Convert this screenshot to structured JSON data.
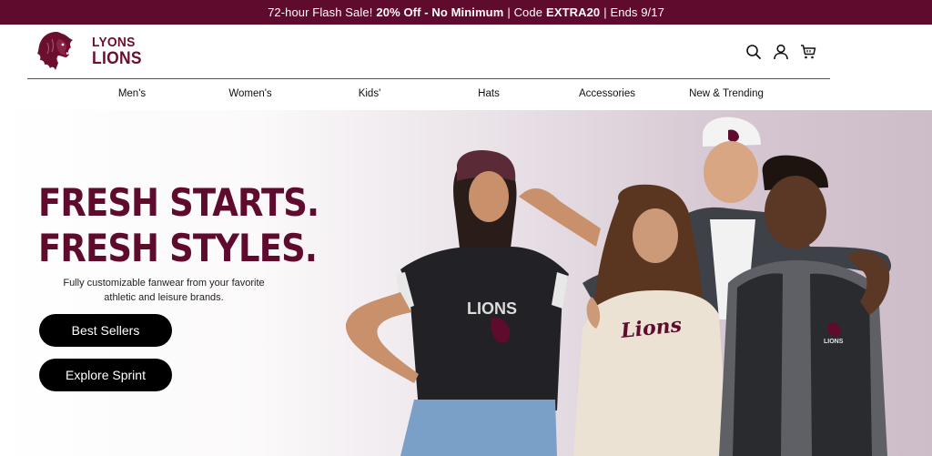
{
  "promo": {
    "part1": "72-hour Flash Sale!",
    "bold": "20% Off - No Minimum",
    "part2": "| Code",
    "code": "EXTRA20",
    "part3": "| Ends 9/17"
  },
  "brand": {
    "line1": "LYONS",
    "line2": "LIONS",
    "color": "#6b0f2e"
  },
  "header_icons": [
    "search-icon",
    "account-icon",
    "cart-icon"
  ],
  "nav": {
    "items": [
      {
        "label": "Men's"
      },
      {
        "label": "Women's"
      },
      {
        "label": "Kids'"
      },
      {
        "label": "Hats"
      },
      {
        "label": "Accessories"
      },
      {
        "label": "New & Trending"
      }
    ]
  },
  "hero": {
    "headline_line1": "FRESH STARTS.",
    "headline_line2": "FRESH STYLES.",
    "subtext": "Fully customizable fanwear from your favorite athletic and leisure brands.",
    "buttons": [
      {
        "label": "Best Sellers"
      },
      {
        "label": "Explore Sprint"
      }
    ],
    "shirt_text_1": "LIONS",
    "shirt_text_2": "Lions",
    "shirt_text_3": "LIONS",
    "accent_color": "#5e0b2e"
  }
}
